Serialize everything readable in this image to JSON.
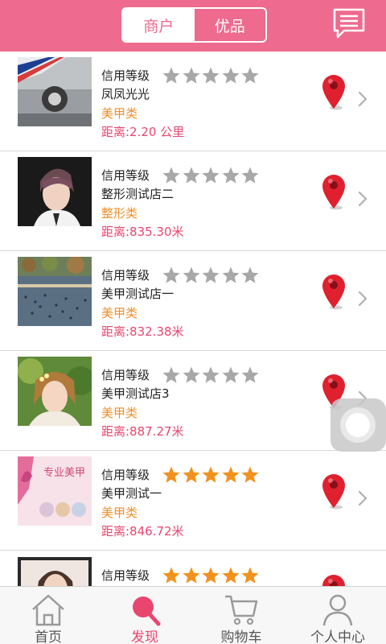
{
  "header": {
    "tabs": [
      {
        "label": "商户",
        "active": true
      },
      {
        "label": "优品",
        "active": false
      }
    ],
    "message_icon": "message-icon"
  },
  "colors": {
    "brand": "#ee6a8e",
    "category": "#ec8f2a",
    "distance": "#e8466f",
    "star_on": "#f2921e",
    "star_off": "#a8a8a8"
  },
  "shops": [
    {
      "credit_label": "信用等级",
      "rating": 0,
      "name": "凤凤光光",
      "category": "美甲类",
      "distance": "距离:2.20 公里",
      "thumb": "car-photo"
    },
    {
      "credit_label": "信用等级",
      "rating": 0,
      "name": "整形测试店二",
      "category": "整形类",
      "distance": "距离:835.30米",
      "thumb": "portrait-photo"
    },
    {
      "credit_label": "信用等级",
      "rating": 0,
      "name": "美甲测试店一",
      "category": "美甲类",
      "distance": "距离:832.38米",
      "thumb": "lake-photo"
    },
    {
      "credit_label": "信用等级",
      "rating": 0,
      "name": "美甲测试店3",
      "category": "美甲类",
      "distance": "距离:887.27米",
      "thumb": "woman-photo"
    },
    {
      "credit_label": "信用等级",
      "rating": 5,
      "name": "美甲测试一",
      "category": "美甲类",
      "distance": "距离:846.72米",
      "thumb": "nail-ad-photo",
      "thumb_text": "专业美甲"
    },
    {
      "credit_label": "信用等级",
      "rating": 5,
      "name": "",
      "category": "",
      "distance": "",
      "thumb": "girl-photo"
    }
  ],
  "tabbar": [
    {
      "label": "首页",
      "icon": "home-icon",
      "active": false
    },
    {
      "label": "发现",
      "icon": "discover-search-icon",
      "active": true
    },
    {
      "label": "购物车",
      "icon": "cart-icon",
      "active": false
    },
    {
      "label": "个人中心",
      "icon": "user-icon",
      "active": false
    }
  ]
}
